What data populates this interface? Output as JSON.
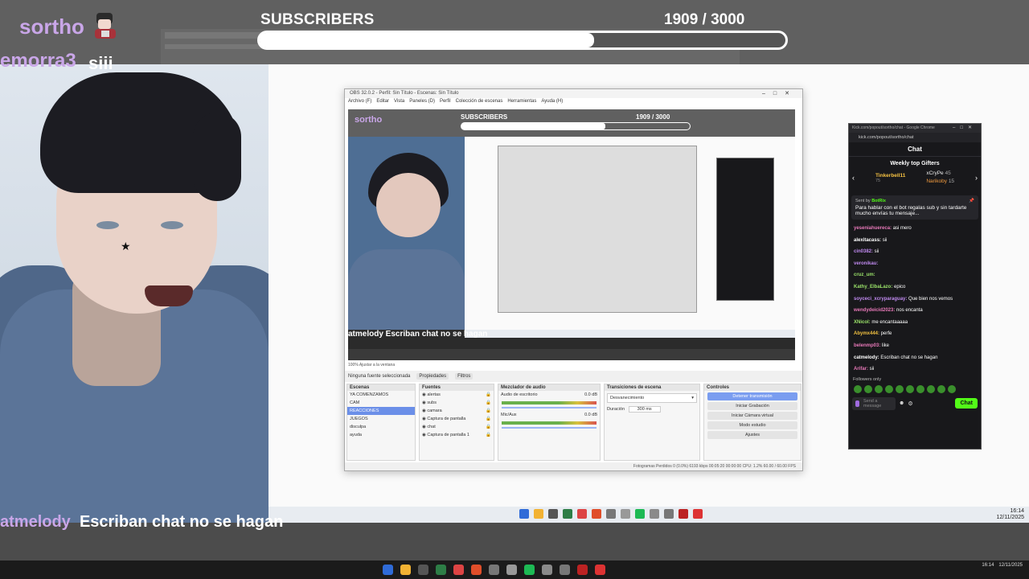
{
  "overlay": {
    "streamer_name": "sortho",
    "subscribers_label": "SUBSCRIBERS",
    "subscribers_count": "1909  / 3000",
    "subscribers_progress": 0.636,
    "ghost_chat_name": "emorra3",
    "ghost_chat_text": "siii",
    "chat_overlay_name": "atmelody",
    "chat_overlay_text": "Escriban chat no se hagan"
  },
  "obs": {
    "title": "OBS 32.0.2 - Perfil: Sin Título - Escenas: Sin Título",
    "menu": [
      "Archivo (F)",
      "Editar",
      "Vista",
      "Paneles (D)",
      "Perfil",
      "Colección de escenas",
      "Herramientas",
      "Ayuda (H)"
    ],
    "preview_name": "sortho",
    "preview_sub_label": "SUBSCRIBERS",
    "preview_sub_count": "1909  / 3000",
    "preview_chat": "atmelody  Escriban chat no se hagan",
    "status_left": "100%   Ajustar a la ventana",
    "source_label": "Ninguna fuente seleccionada",
    "props_button": "Propiedades",
    "filters_button": "Filtros",
    "docks": {
      "scenes_title": "Escenas",
      "scenes": [
        "YA COMENZAMOS",
        "CAM",
        "REACCIONES",
        "JUEGOS",
        "disculpa",
        "ayuda"
      ],
      "scenes_selected": 2,
      "sources_title": "Fuentes",
      "sources": [
        "alertas",
        "subs",
        "camara",
        "Captura de pantalla",
        "chat",
        "Captura de pantalla 1"
      ],
      "mixer_title": "Mezclador de audio",
      "mixer_channels": [
        "Audio de escritorio",
        "Mic/Aux"
      ],
      "mixer_db": "0.0 dB",
      "transitions_title": "Transiciones de escena",
      "transition_value": "Desvanecimiento",
      "duration_label": "Duración",
      "duration_value": "300 ms",
      "controls_title": "Controles",
      "controls": [
        "Detener transmisión",
        "Iniciar Grabación",
        "Iniciar Cámara virtual",
        "Modo estudio",
        "Ajustes"
      ]
    },
    "footer": "Fotogramas Perdidos 0 (0.0%)    6193 kbps    00:05:20    00:00:00    CPU: 1.2%    60.00 / 60.00 FPS"
  },
  "chat": {
    "window_title": "Kick.com/popout/sortho/chat - Google Chrome",
    "url": "kick.com/popout/sortho/chat",
    "header": "Chat",
    "gifters_title": "Weekly top Gifters",
    "gifters": [
      {
        "name": "Tinkerbell11",
        "amount": "75"
      },
      {
        "name": "xCryPe",
        "amount": "45"
      },
      {
        "name": "Narikoby",
        "amount": "15"
      }
    ],
    "pinned_from": "Sent by",
    "pinned_bot": "BotRix",
    "pinned_text": "Para hablar con el bot regalas sub y sin tardarte mucho envías tu mensaje...",
    "messages": [
      {
        "user": "yeseniahuereca",
        "color": "#e879b9",
        "text": "asi mero"
      },
      {
        "user": "alexitacass",
        "color": "#ffffff",
        "text": "sii"
      },
      {
        "user": "cin0382",
        "color": "#c08af0",
        "text": "sii"
      },
      {
        "user": "veronikau",
        "color": "#c08af0",
        "text": ""
      },
      {
        "user": "cruz_um",
        "color": "#9be36a",
        "text": ""
      },
      {
        "user": "Kathy_ElbaLazo",
        "color": "#9be36a",
        "text": "epico"
      },
      {
        "user": "soyceci_xcryparaguay",
        "color": "#c08af0",
        "text": "Que bien nos vemos"
      },
      {
        "user": "wendydeicid2023",
        "color": "#e879b9",
        "text": "nos encanta"
      },
      {
        "user": "XNicol",
        "color": "#9be36a",
        "text": "me encantaaaaa"
      },
      {
        "user": "Abymx444",
        "color": "#f0c040",
        "text": "perfe"
      },
      {
        "user": "belenmp03",
        "color": "#e879b9",
        "text": "like"
      },
      {
        "user": "catmelody",
        "color": "#ffffff",
        "text": "Escriban chat no se hagan"
      },
      {
        "user": "Arifar",
        "color": "#e879b9",
        "text": "sii"
      }
    ],
    "followers_only": "Followers only",
    "send_placeholder": "Send a message",
    "chat_button": "Chat"
  },
  "clock": {
    "time": "16:14",
    "date": "12/11/2025"
  }
}
